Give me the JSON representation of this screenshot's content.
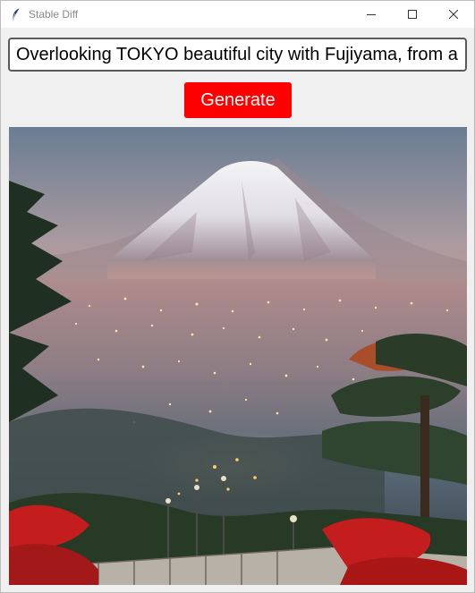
{
  "window": {
    "title": "Stable Diff",
    "controls": [
      "minimize-icon",
      "maximize-icon",
      "close-icon"
    ]
  },
  "prompt": {
    "value": "Overlooking TOKYO beautiful city with Fujiyama, from a t"
  },
  "generate_button": {
    "label": "Generate",
    "background_color": "#ff0000",
    "text_color": "#ffffff"
  },
  "generated_image": {
    "subject": "mount-fuji-over-tokyo-cityscape-painting"
  }
}
